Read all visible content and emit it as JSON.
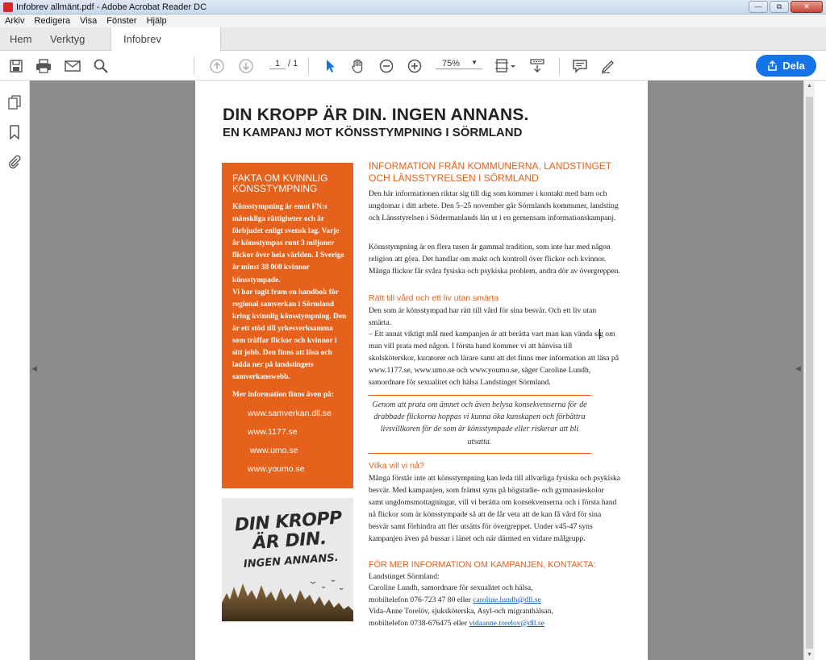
{
  "window": {
    "title": "Infobrev allmänt.pdf - Adobe Acrobat Reader DC"
  },
  "menu": [
    "Arkiv",
    "Redigera",
    "Visa",
    "Fönster",
    "Hjälp"
  ],
  "tabs": {
    "home": "Hem",
    "tools": "Verktyg",
    "document": "Infobrev allmänt.pdf",
    "close": "×"
  },
  "toolbar": {
    "page_current": "1",
    "page_total": "/ 1",
    "zoom": "75%",
    "share_label": "Dela"
  },
  "colors": {
    "accent_orange": "#e6611b",
    "share_blue": "#1473e6",
    "workspace_gray": "#8c8c8c"
  },
  "document": {
    "title": "DIN KROPP ÄR DIN. INGEN ANNANS.",
    "subtitle": "EN KAMPANJ MOT KÖNSSTYMPNING I SÖRMLAND",
    "facts": {
      "heading": "FAKTA OM KVINNLIG KÖNSSTYMPNING",
      "p1": "Könsstympning är emot FN:s mänskliga rättigheter och är förbjudet enligt svensk lag. Varje år könsstympas runt 3 miljoner flickor över hela världen. I Sverige är minst 38 000 kvinnor könsstympade.",
      "p2": "Vi har tagit fram en handbok för regional samverkan i Sörmland kring kvinnlig könsstympning. Den är ett stöd till yrkesverksamma som träffar flickor och kvinnor i sitt jobb. Den finns att läsa och ladda ner på landstingets samverkanswebb.",
      "more": "Mer information finns även på:",
      "links": [
        "www.samverkan.dll.se",
        "www.1177.se",
        "www.umo.se",
        "www.youmo.se"
      ]
    },
    "poster": {
      "line1": "DIN KROPP",
      "line2": "ÄR DIN.",
      "line3": "INGEN ANNANS."
    },
    "info_heading": "INFORMATION FRÅN KOMMUNERNA, LANDSTINGET OCH LÄNSSTYRELSEN I SÖRMLAND",
    "info_p1": "Den här informationen riktar sig till dig som kommer i kontakt med barn och ungdomar i ditt arbete. Den 5–25 november går Sörmlands kommuner, landsting och Länsstyrelsen i Södermanlands län ut i en gemensam informationskampanj.",
    "info_p2": "Könsstympning är en flera tusen år gammal tradition, som inte har med någon religion att göra. Det handlar om makt och kontroll över flickor och kvinnor. Många flickor får svåra fysiska och psykiska problem, andra dör av övergreppen.",
    "rights_heading": "Rätt till vård och ett liv utan smärta",
    "rights_p1": "Den som är könsstympad har rätt till vård för sina besvär. Och ett liv utan smärta.",
    "rights_p2": "– Ett annat viktigt mål med kampanjen är att berätta vart man kan vända sig om man vill prata med någon. I första hand kommer vi att hänvisa till skolsköterskor, kuratorer och lärare samt att det finns mer information att läsa på www.1177.se, www.umo.se och www.youmo.se, säger Caroline Lundh, samordnare för sexualitet och hälsa Landstinget Sörmland.",
    "quote": "Genom att prata om ämnet och även belysa konsekvenserna för de drabbade flickorna hoppas vi kunna öka kunskapen och förbättra livsvillkoren för de som är könsstympade eller riskerar att bli utsatta.",
    "goal_heading": "Vilka vill vi nå?",
    "goal_p": "Många förstår inte att könsstympning kan leda till allvarliga fysiska och psykiska besvär. Med kampanjen, som främst syns på högstadie- och gymnasieskolor samt ungdomsmottagningar, vill vi berätta om konsekvenserna och i första hand nå flickor som är könsstympade så att de får veta att de kan få vård för sina besvär samt förhindra att fler utsätts för övergreppet. Under v45-47 syns kampanjen även på bussar i länet och när därmed en vidare målgrupp.",
    "contact_heading": "FÖR MER INFORMATION OM KAMPANJEN, KONTAKTA:",
    "contact": {
      "org": "Landstinget Sörmland:",
      "c1": "Caroline Lundh, samordnare för sexualitet och hälsa,",
      "c1_phone": "mobiltelefon 076-723 47 80 eller",
      "c1_email": "caroline.lundh@dll.se",
      "c2": "Vida-Anne Torelöv, sjuksköterska, Asyl-och migranthälsan,",
      "c2_phone": "mobiltelefon 0738-676475 eller",
      "c2_email": "vidaanne.torelov@dll.se"
    }
  }
}
